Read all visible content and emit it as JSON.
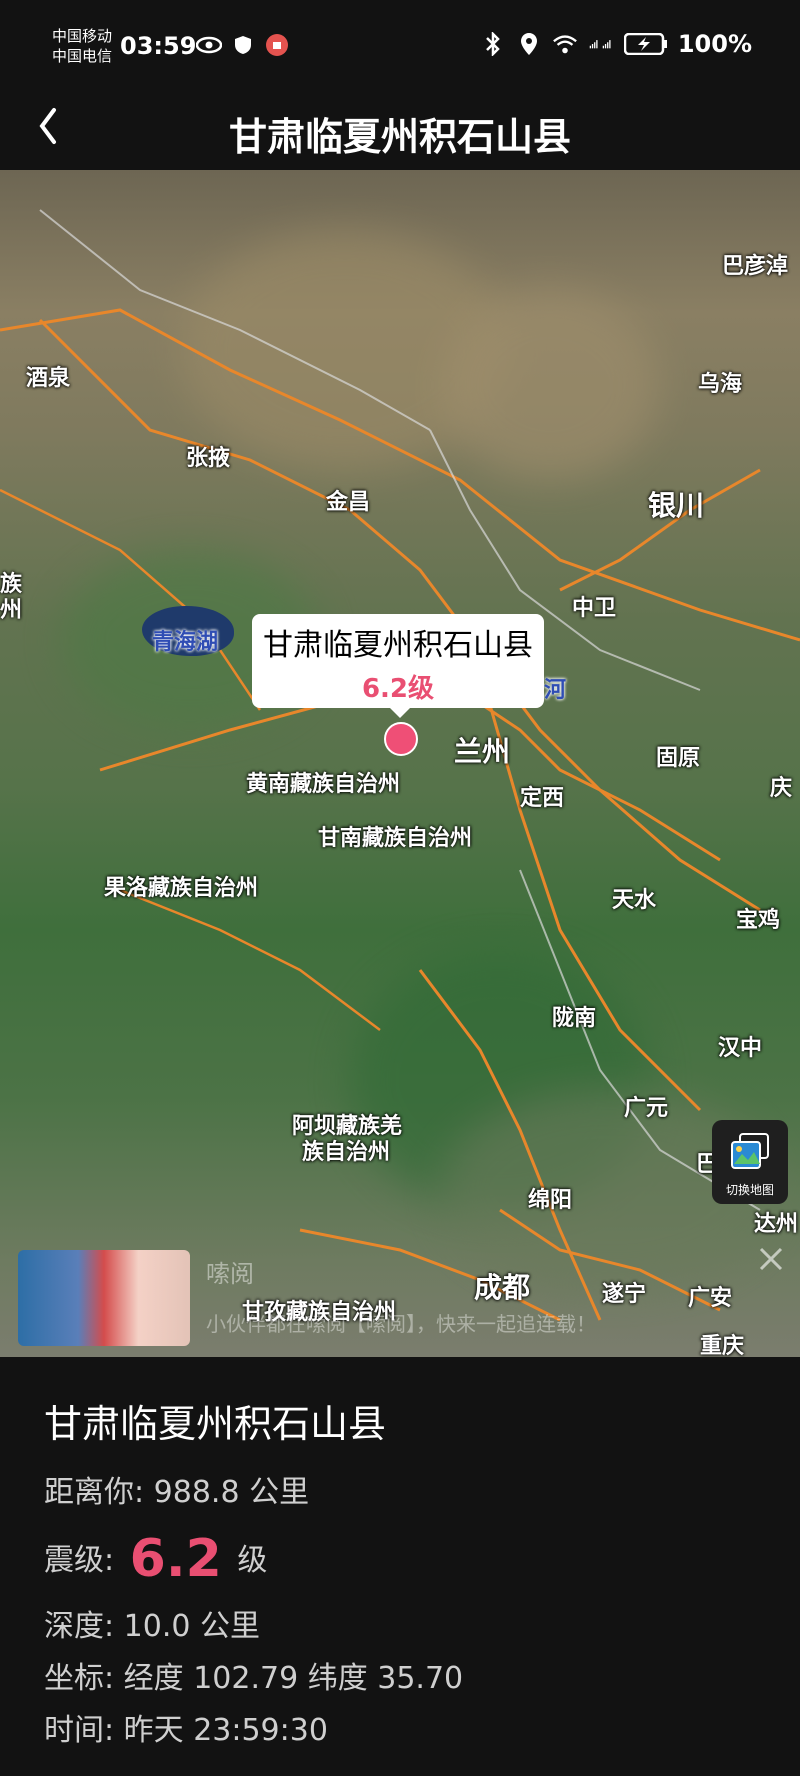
{
  "status": {
    "carrier1": "中国移动",
    "carrier2": "中国电信",
    "time": "03:59",
    "battery": "100%"
  },
  "header": {
    "title": "甘肃临夏州积石山县"
  },
  "map": {
    "cities": {
      "bayannur": "巴彦淖",
      "jiuquan": "酒泉",
      "wuhai": "乌海",
      "zhangye": "张掖",
      "jinchang": "金昌",
      "yinchuan": "银川",
      "zu": "族",
      "zhou": "州",
      "zhongwei": "中卫",
      "qinghaihu": "青海湖",
      "he": "河",
      "lanzhou": "兰州",
      "guyuan": "固原",
      "qing": "庆",
      "huangnan": "黄南藏族自治州",
      "dingxi": "定西",
      "gannan": "甘南藏族自治州",
      "guoluo": "果洛藏族自治州",
      "tianshui": "天水",
      "baoji": "宝鸡",
      "longnan": "陇南",
      "hanzhong": "汉中",
      "guangyuan": "广元",
      "aba1": "阿坝藏族羌",
      "aba2": "族自治州",
      "ba": "巴",
      "mianyang": "绵阳",
      "dazhou": "达州",
      "chengdu": "成都",
      "suining": "遂宁",
      "guangan": "广安",
      "ganzi": "甘孜藏族自治州",
      "chongqing": "重庆"
    },
    "callout": {
      "name": "甘肃临夏州积石山县",
      "magnitude": "6.2级"
    },
    "switch_label": "切换地图",
    "ad": {
      "brand": "嗦阅",
      "text": "小伙伴都在嗦阅【嗦阅】，快来一起追连载！"
    }
  },
  "info": {
    "name": "甘肃临夏州积石山县",
    "distance_label": "距离你:",
    "distance_value": "988.8 公里",
    "magnitude_label": "震级:",
    "magnitude_value": "6.2",
    "magnitude_unit": "级",
    "depth_label": "深度:",
    "depth_value": "10.0 公里",
    "coord_label": "坐标:",
    "coord_value": "经度 102.79 纬度 35.70",
    "time_label": "时间:",
    "time_value": "昨天 23:59:30"
  },
  "colors": {
    "accent": "#e94f72",
    "background": "#121212"
  },
  "icons": [
    "eye-icon",
    "shield-icon",
    "vpn-icon",
    "bluetooth-icon",
    "location-icon",
    "wifi-icon",
    "signal-icon",
    "battery-icon",
    "back-icon",
    "switch-map-icon",
    "close-icon"
  ]
}
